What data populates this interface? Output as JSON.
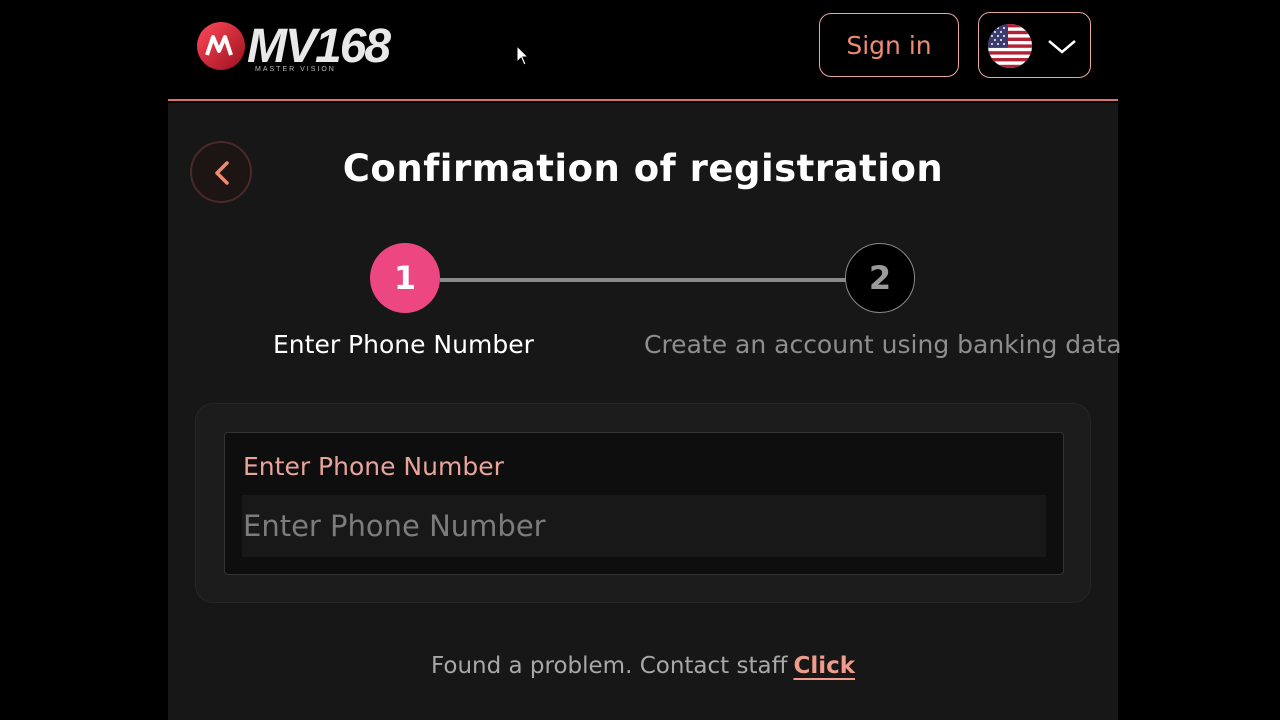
{
  "header": {
    "logo_main": "MV168",
    "logo_sub": "MASTER VISION",
    "signin_label": "Sign in",
    "language_flag": "us-flag-icon"
  },
  "main": {
    "title": "Confirmation of registration",
    "steps": [
      {
        "number": "1",
        "label": "Enter Phone Number",
        "active": true
      },
      {
        "number": "2",
        "label": "Create an account using banking data",
        "active": false
      }
    ],
    "form": {
      "phone_label": "Enter Phone Number",
      "phone_placeholder": "Enter Phone Number",
      "phone_value": ""
    },
    "footer": {
      "text": "Found a problem. Contact staff",
      "link": "Click"
    }
  },
  "colors": {
    "accent": "#ec4780",
    "outline": "#eaa7a0",
    "link": "#ef9c8c",
    "background": "#000000",
    "panel": "#171717"
  }
}
